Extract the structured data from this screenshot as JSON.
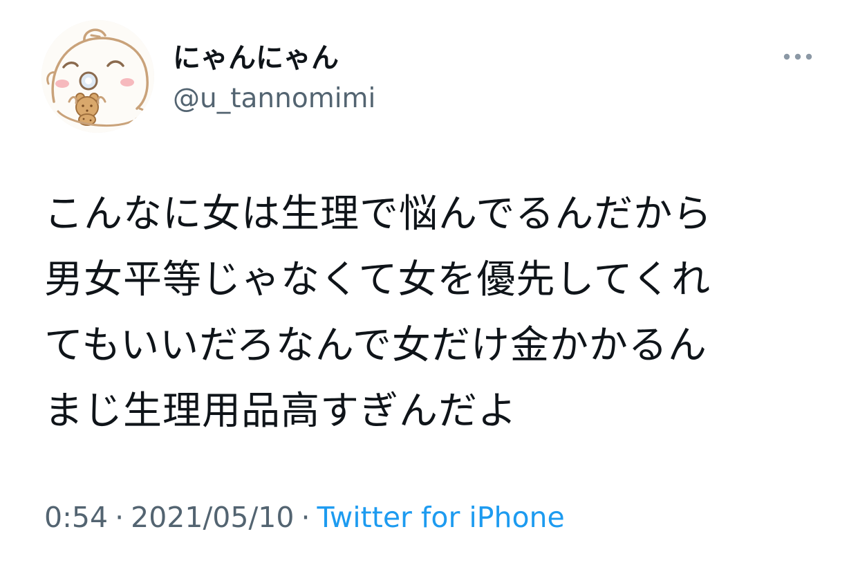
{
  "user": {
    "display_name": "にゃんにゃん",
    "handle": "@u_tannomimi",
    "avatar_icon": "bear-avatar-icon"
  },
  "menu": {
    "more_icon": "more-horizontal-icon"
  },
  "tweet": {
    "lines": [
      "こんなに女は生理で悩んでるんだから",
      "男女平等じゃなくて女を優先してくれ",
      "てもいいだろなんで女だけ金かかるん",
      "まじ生理用品高すぎんだよ"
    ]
  },
  "meta": {
    "time": "0:54",
    "separator": "·",
    "date": "2021/05/10",
    "source": "Twitter for iPhone"
  },
  "colors": {
    "text": "#0f1419",
    "secondary": "#536471",
    "link": "#1d9bf0"
  }
}
